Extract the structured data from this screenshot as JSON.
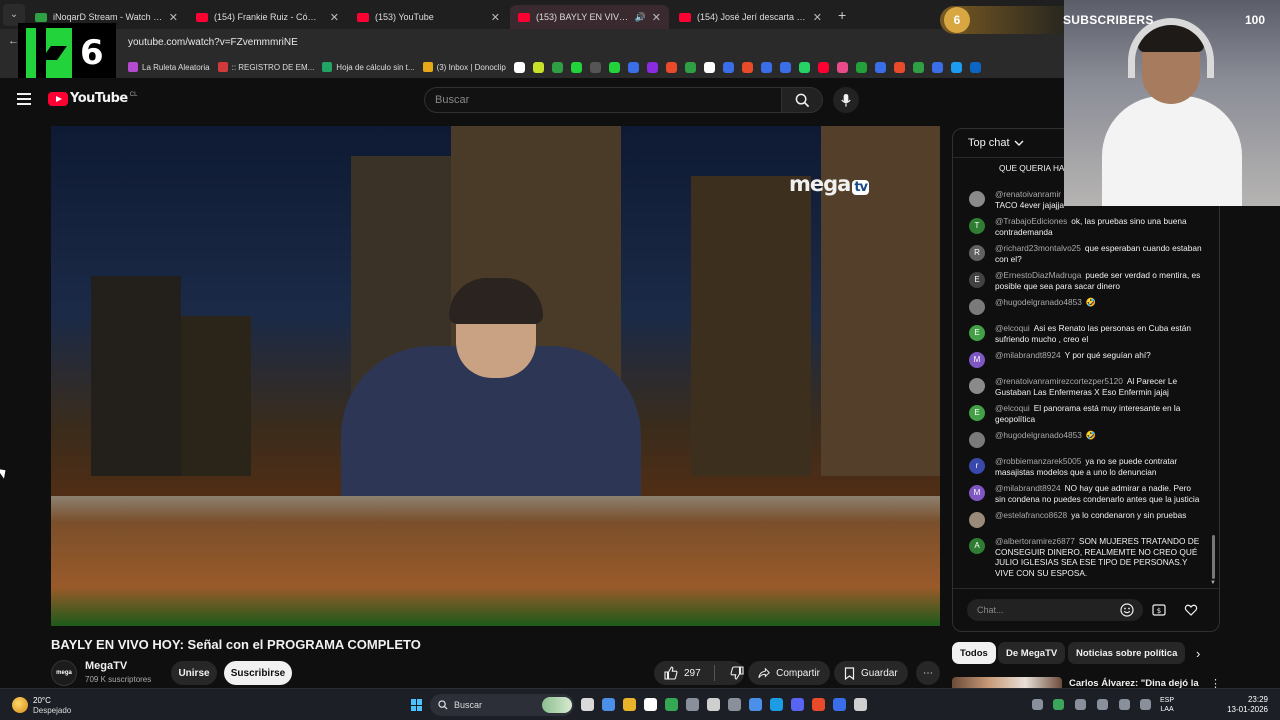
{
  "browser": {
    "tabs": [
      {
        "title": "iNoqarD Stream - Watch Live o",
        "favicon_color": "#2ea043",
        "active": false
      },
      {
        "title": "(154) Frankie Ruiz - Cómo Lo H",
        "favicon_color": "#ff0033",
        "active": false
      },
      {
        "title": "(153) YouTube",
        "favicon_color": "#ff0033",
        "active": false
      },
      {
        "title": "(153) BAYLY EN VIVO HOY:",
        "favicon_color": "#ff0033",
        "active": true
      },
      {
        "title": "(154) José Jerí descarta corredo",
        "favicon_color": "#ff0033",
        "active": false
      }
    ],
    "tab_close": "✕",
    "new_tab": "+",
    "url": "youtube.com/watch?v=FZvemmmriNE",
    "bookmarks": [
      {
        "label": "La Ruleta Aleatoria",
        "color": "#b44ad0"
      },
      {
        "label": ":: REGISTRO DE EM...",
        "color": "#d03a3a"
      },
      {
        "label": "Hoja de cálculo sin t...",
        "color": "#1fa463"
      },
      {
        "label": "(3) Inbox | Donoclip",
        "color": "#e6a817"
      }
    ],
    "bookmark_icon_colors": [
      "#ffffff",
      "#c9e02a",
      "#2ea043",
      "#22d33b",
      "#555555",
      "#22d33b",
      "#3a6ee8",
      "#8a2be2",
      "#e84a2a",
      "#2ea043",
      "#ffffff",
      "#3a6ee8",
      "#e84a2a",
      "#3a6ee8",
      "#3a6ee8",
      "#25d366",
      "#ff0033",
      "#e84a8a",
      "#22a03a",
      "#3a6ee8",
      "#e84a2a",
      "#2ea043",
      "#3a6ee8",
      "#1d9bf0",
      "#0a66c2"
    ]
  },
  "overlay": {
    "logo_k": "K",
    "logo_number": "6",
    "subscriber_count": "6",
    "subscriber_label": "SUBSCRIBERS",
    "subscriber_goal": "100"
  },
  "youtube": {
    "logo_text": "YouTube",
    "country_code": "CL",
    "search_placeholder": "Buscar",
    "icons": {
      "menu": "hamburger-icon",
      "search": "search-icon",
      "mic": "mic-icon"
    }
  },
  "video": {
    "watermark": "mega",
    "watermark_badge": "tv",
    "title": "BAYLY EN VIVO HOY: Señal con el PROGRAMA COMPLETO",
    "channel_name": "MegaTV",
    "channel_avatar_text": "mega",
    "subscribers": "709 K suscriptores",
    "join_label": "Unirse",
    "subscribe_label": "Suscribirse",
    "likes": "297",
    "share_label": "Compartir",
    "save_label": "Guardar",
    "more": "⋯"
  },
  "chat": {
    "header": "Top chat",
    "input_placeholder": "Chat...",
    "messages": [
      {
        "author": "",
        "text": "QUE QUERIA HAY YA ESTA PARA MO",
        "avatar_letter": "",
        "avatar_color": "#0f0f0f"
      },
      {
        "author": "@renatoivanramir",
        "text": "Se Dice El Santo Se... EL Caso VIVA TACO 4ever jajajja",
        "avatar_letter": "",
        "avatar_color": "#8a8a8a"
      },
      {
        "author": "@TrabajoEdiciones",
        "text": "ok, las pruebas sino una buena contrademanda",
        "avatar_letter": "T",
        "avatar_color": "#2e7d32"
      },
      {
        "author": "@richard23montalvo25",
        "text": "que esperaban cuando estaban con el?",
        "avatar_letter": "R",
        "avatar_color": "#616161"
      },
      {
        "author": "@ErnestoDiazMadruga",
        "text": "puede ser verdad o mentira, es posible que sea para sacar dinero",
        "avatar_letter": "E",
        "avatar_color": "#424242"
      },
      {
        "author": "@hugodelgranado4853",
        "text": "🤣",
        "avatar_letter": "",
        "avatar_color": "#7a7a7a"
      },
      {
        "author": "@elcoqui",
        "text": "Asi es Renato las personas en Cuba están sufriendo mucho , creo el",
        "avatar_letter": "E",
        "avatar_color": "#43a047"
      },
      {
        "author": "@milabrandt8924",
        "text": "Y por qué seguían ahí?",
        "avatar_letter": "M",
        "avatar_color": "#7e57c2"
      },
      {
        "author": "@renatoivanramirezcortezper5120",
        "text": "Al Parecer Le Gustaban Las Enfermeras X Eso Enfermin jajaj",
        "avatar_letter": "",
        "avatar_color": "#8a8a8a"
      },
      {
        "author": "@elcoqui",
        "text": "El panorama está muy interesante en la geopolítica",
        "avatar_letter": "E",
        "avatar_color": "#43a047"
      },
      {
        "author": "@hugodelgranado4853",
        "text": "🤣",
        "avatar_letter": "",
        "avatar_color": "#7a7a7a"
      },
      {
        "author": "@robbiemanzarek5005",
        "text": "ya no se puede contratar masajistas modelos que a uno lo denuncian",
        "avatar_letter": "r",
        "avatar_color": "#3949ab"
      },
      {
        "author": "@milabrandt8924",
        "text": "NO hay que admirar a nadie. Pero sin condena no puedes condenarlo antes que la justicia",
        "avatar_letter": "M",
        "avatar_color": "#7e57c2"
      },
      {
        "author": "@estelafranco8628",
        "text": "ya lo condenaron y sin pruebas",
        "avatar_letter": "",
        "avatar_color": "#9a8a7a"
      },
      {
        "author": "@albertoramirez6877",
        "text": "SON MUJERES TRATANDO DE CONSEGUIR DINERO, REALMEMTE NO CREO QUÉ JULIO IGLESIAS SEA ESE TIPO DE PERSONAS.Y VIVE CON SU ESPOSA.",
        "avatar_letter": "A",
        "avatar_color": "#2e7d32"
      }
    ]
  },
  "chips": [
    {
      "label": "Todos",
      "active": true
    },
    {
      "label": "De MegaTV",
      "active": false
    },
    {
      "label": "Noticias sobre política",
      "active": false
    }
  ],
  "recommendation": {
    "title": "Carlos Álvarez: \"Dina dejó la",
    "more": "⋮"
  },
  "taskbar": {
    "temperature": "20°C",
    "weather": "Despejado",
    "search_placeholder": "Buscar",
    "language_line1": "ESP",
    "language_line2": "LAA",
    "time": "23:29",
    "date": "13-01-2026",
    "app_colors": [
      "#d9d9d9",
      "#4a8fe8",
      "#e8b42a",
      "#ffffff",
      "#34a853",
      "#8a8f9c",
      "#cfcfcf",
      "#8a8f9c",
      "#4a8fe8",
      "#1b9ce5",
      "#5865f2",
      "#e84a2a",
      "#3a6ee8",
      "#cfcfcf"
    ]
  }
}
